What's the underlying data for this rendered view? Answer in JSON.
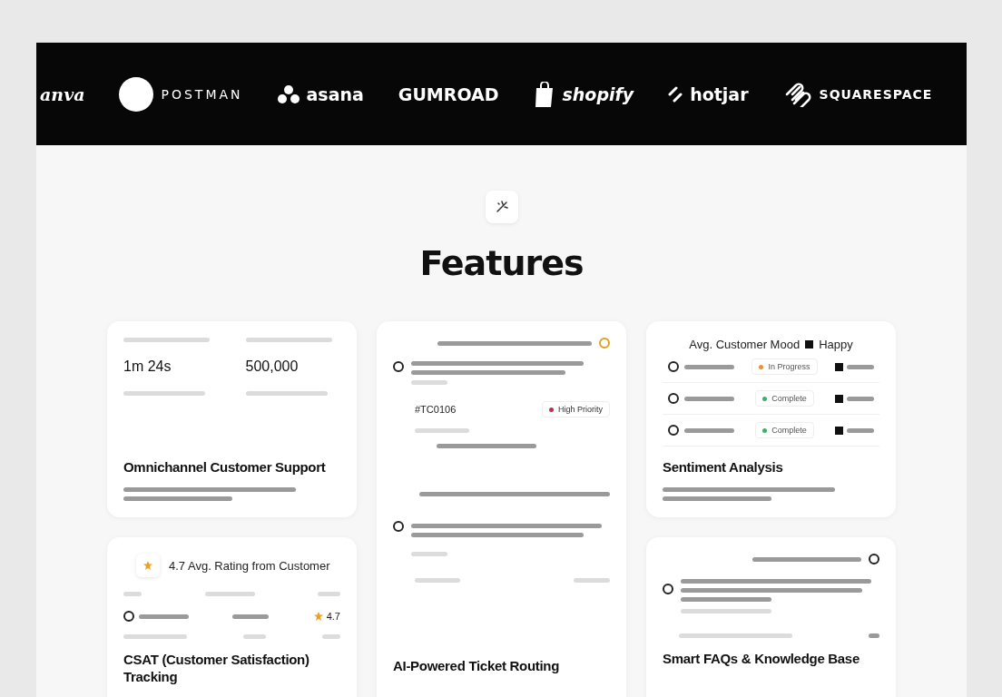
{
  "logos": [
    {
      "kind": "script",
      "label": "anva"
    },
    {
      "kind": "circle",
      "label": "POSTMAN"
    },
    {
      "kind": "dots",
      "label": "asana"
    },
    {
      "kind": "plain",
      "label": "GUMROAD"
    },
    {
      "kind": "bag",
      "label": "shopify"
    },
    {
      "kind": "slash",
      "label": "hotjar"
    },
    {
      "kind": "stripes",
      "label": "SQUARESPACE"
    }
  ],
  "section": {
    "title": "Features"
  },
  "cards": [
    {
      "kind": "stats",
      "title": "Omnichannel Customer Support",
      "stats": [
        {
          "value": "1m 24s"
        },
        {
          "value": "500,000"
        }
      ]
    },
    {
      "kind": "routing",
      "title": "AI-Powered Ticket Routing",
      "ticket": "#TC0106",
      "priority": {
        "label": "High Priority",
        "color": "#c0304a"
      }
    },
    {
      "kind": "sentiment",
      "title": "Sentiment Analysis",
      "mood_label": "Avg. Customer Mood",
      "mood": "Happy",
      "rows": [
        {
          "status": "In Progress",
          "color": "#e8923a"
        },
        {
          "status": "Complete",
          "color": "#3fae6a"
        },
        {
          "status": "Complete",
          "color": "#3fae6a"
        }
      ]
    },
    {
      "kind": "csat",
      "title": "CSAT (Customer Satisfaction) Tracking",
      "rating": "4.7 Avg. Rating from Customer",
      "rows": [
        {
          "rating": "4.7"
        }
      ]
    },
    {
      "kind": "faq",
      "title": "Smart FAQs & Knowledge Base"
    }
  ]
}
